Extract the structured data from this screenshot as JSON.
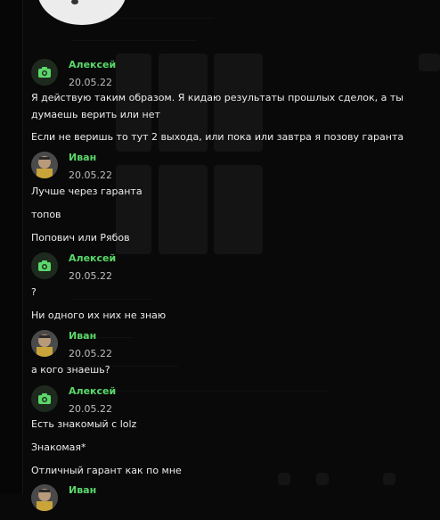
{
  "users": {
    "aleksey": "Алексей",
    "ivan": "Иван"
  },
  "dates": {
    "d1": "20.05.22"
  },
  "messages": [
    {
      "id": "m1",
      "author": "Алексей",
      "date": "20.05.22",
      "lines": [
        "Я действую таким образом. Я кидаю результаты прошлых сделок, а ты",
        "думаешь верить или нет",
        "Если не веришь то тут 2 выхода, или пока или завтра я позову гаранта"
      ]
    },
    {
      "id": "m2",
      "author": "Иван",
      "date": "20.05.22",
      "lines": [
        "Лучше через гаранта",
        "топов",
        "Попович или Рябов"
      ]
    },
    {
      "id": "m3",
      "author": "Алексей",
      "date": "20.05.22",
      "lines": [
        "?",
        "Ни одного их них не знаю"
      ]
    },
    {
      "id": "m4",
      "author": "Иван",
      "date": "20.05.22",
      "lines": [
        "а кого знаешь?"
      ]
    },
    {
      "id": "m5",
      "author": "Алексей",
      "date": "20.05.22",
      "lines": [
        "Есть знакомый с lolz",
        "Знакомая*",
        "Отличный гарант как по мне"
      ]
    },
    {
      "id": "m6",
      "author": "Иван",
      "date": "",
      "lines": []
    }
  ],
  "colors": {
    "name": "#5bd86a",
    "background": "#090909",
    "camera_icon": "#5bd86a"
  },
  "icons": {
    "camera_avatar": "camera-icon",
    "user_avatar": "user-photo"
  }
}
